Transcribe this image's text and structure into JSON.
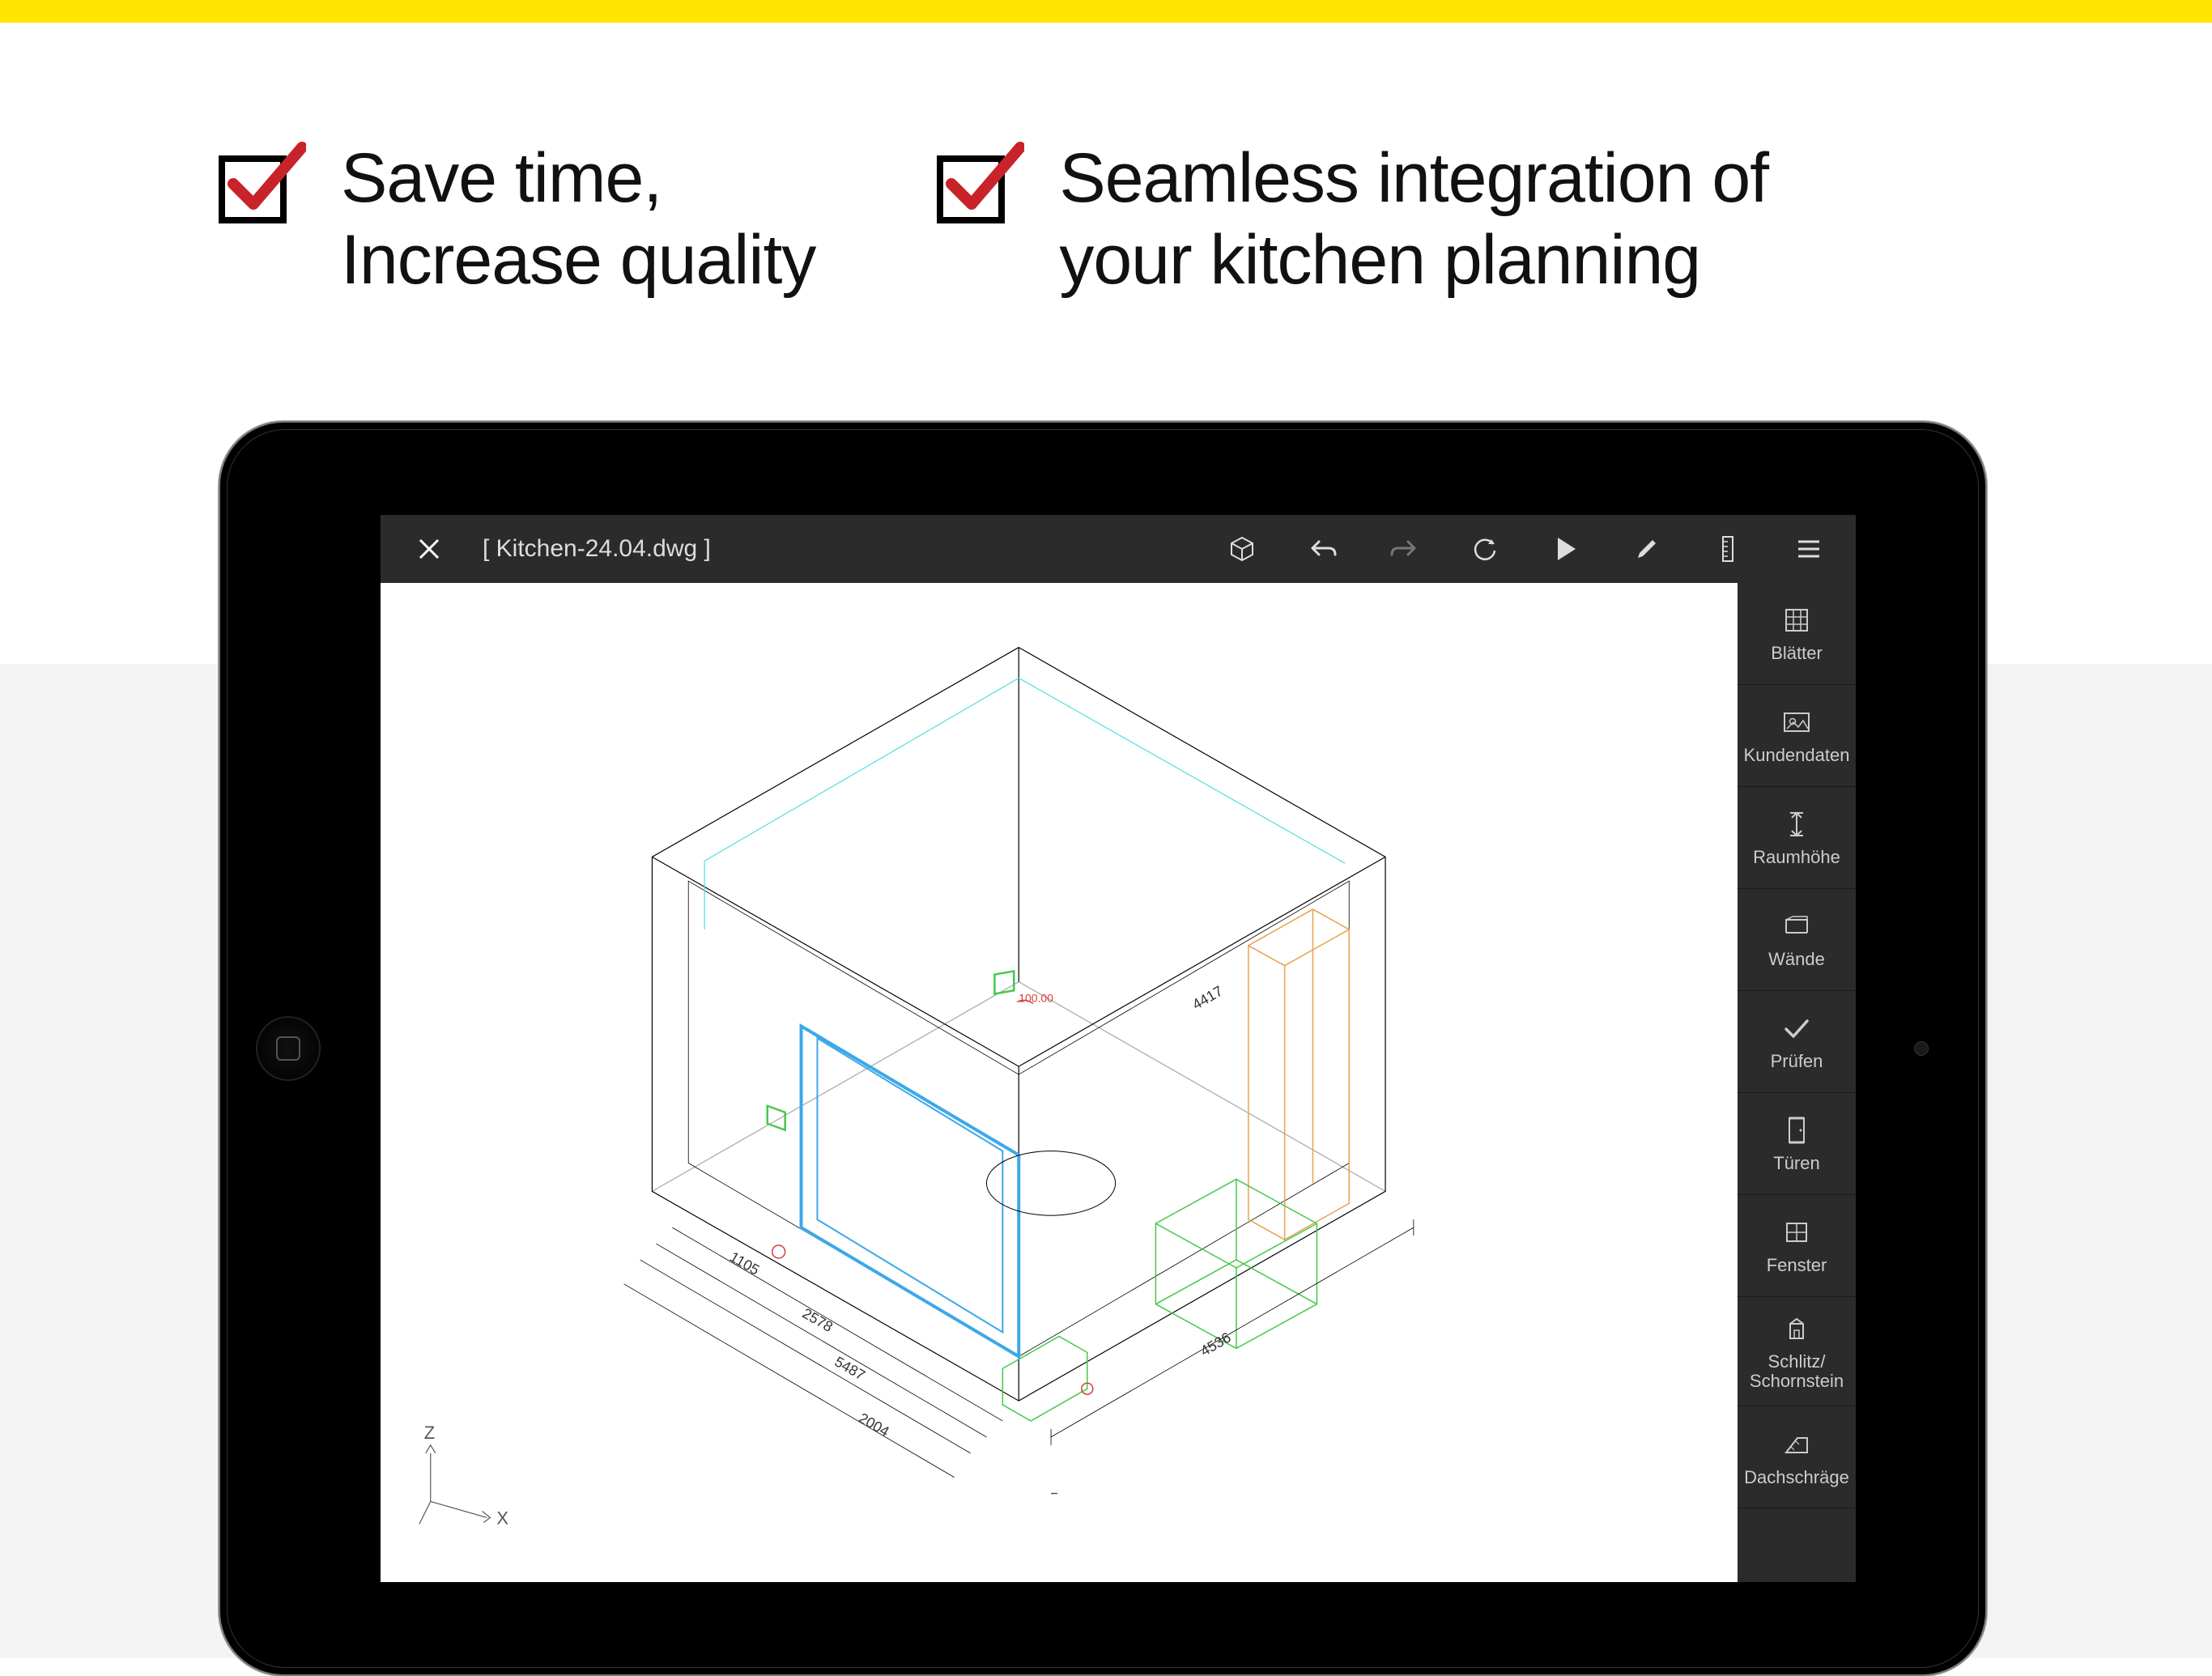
{
  "features": [
    {
      "line1": "Save time,",
      "line2": "Increase quality"
    },
    {
      "line1": "Seamless integration of",
      "line2": "your kitchen planning"
    }
  ],
  "app": {
    "filename": "[ Kitchen-24.04.dwg ]",
    "toolbar_icons": {
      "close": "close-icon",
      "cube": "cube-icon",
      "undo": "undo-icon",
      "redo": "redo-icon",
      "sync": "refresh-icon",
      "play": "play-icon",
      "edit": "pencil-icon",
      "ruler": "ruler-icon",
      "menu": "menu-icon"
    },
    "panel": [
      {
        "label": "Blätter",
        "name": "tool-blatter"
      },
      {
        "label": "Kundendaten",
        "name": "tool-kundendaten"
      },
      {
        "label": "Raumhöhe",
        "name": "tool-raumhoehe"
      },
      {
        "label": "Wände",
        "name": "tool-waende"
      },
      {
        "label": "Prüfen",
        "name": "tool-pruefen"
      },
      {
        "label": "Türen",
        "name": "tool-tueren"
      },
      {
        "label": "Fenster",
        "name": "tool-fenster"
      },
      {
        "label": "Schlitz/\nSchornstein",
        "name": "tool-schlitz"
      },
      {
        "label": "Dachschräge",
        "name": "tool-dachschraege"
      }
    ],
    "drawing_dimensions": [
      "1105",
      "2578",
      "5487",
      "2004",
      "4536",
      "4417",
      "100.00"
    ]
  }
}
